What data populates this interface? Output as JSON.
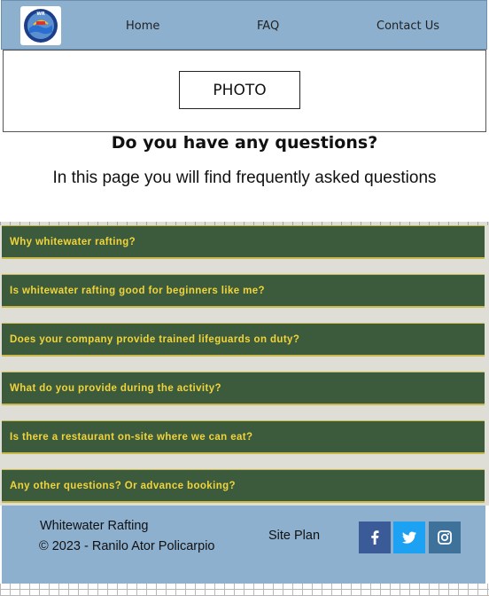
{
  "header": {
    "logo_alt": "Whitewater Rafting",
    "nav": [
      {
        "label": "Home"
      },
      {
        "label": "FAQ"
      },
      {
        "label": "Contact Us"
      }
    ]
  },
  "hero": {
    "photo_label": "PHOTO"
  },
  "intro": {
    "heading": "Do you have any questions?",
    "subheading": "In this page you will find frequently asked questions"
  },
  "faq": {
    "items": [
      {
        "question": "Why whitewater rafting?"
      },
      {
        "question": "Is whitewater rafting good for beginners like me?"
      },
      {
        "question": "Does your company provide trained lifeguards on duty?"
      },
      {
        "question": "What do you provide during the activity?"
      },
      {
        "question": "Is there a restaurant on-site where we can eat?"
      },
      {
        "question": "Any other questions? Or advance booking?"
      }
    ]
  },
  "footer": {
    "brand": "Whitewater Rafting",
    "copyright": "© 2023 - Ranilo Ator Policarpio",
    "site_plan": "Site Plan",
    "social": [
      {
        "icon": "facebook-icon",
        "color": "#3b5b98"
      },
      {
        "icon": "twitter-icon",
        "color": "#1da1f2"
      },
      {
        "icon": "instagram-icon",
        "color": "#3f729b"
      }
    ]
  },
  "colors": {
    "header_bg": "#8db0cf",
    "faq_bg": "#3b5b3c",
    "faq_text": "#f2d43a",
    "faq_border": "#c9b94a"
  }
}
